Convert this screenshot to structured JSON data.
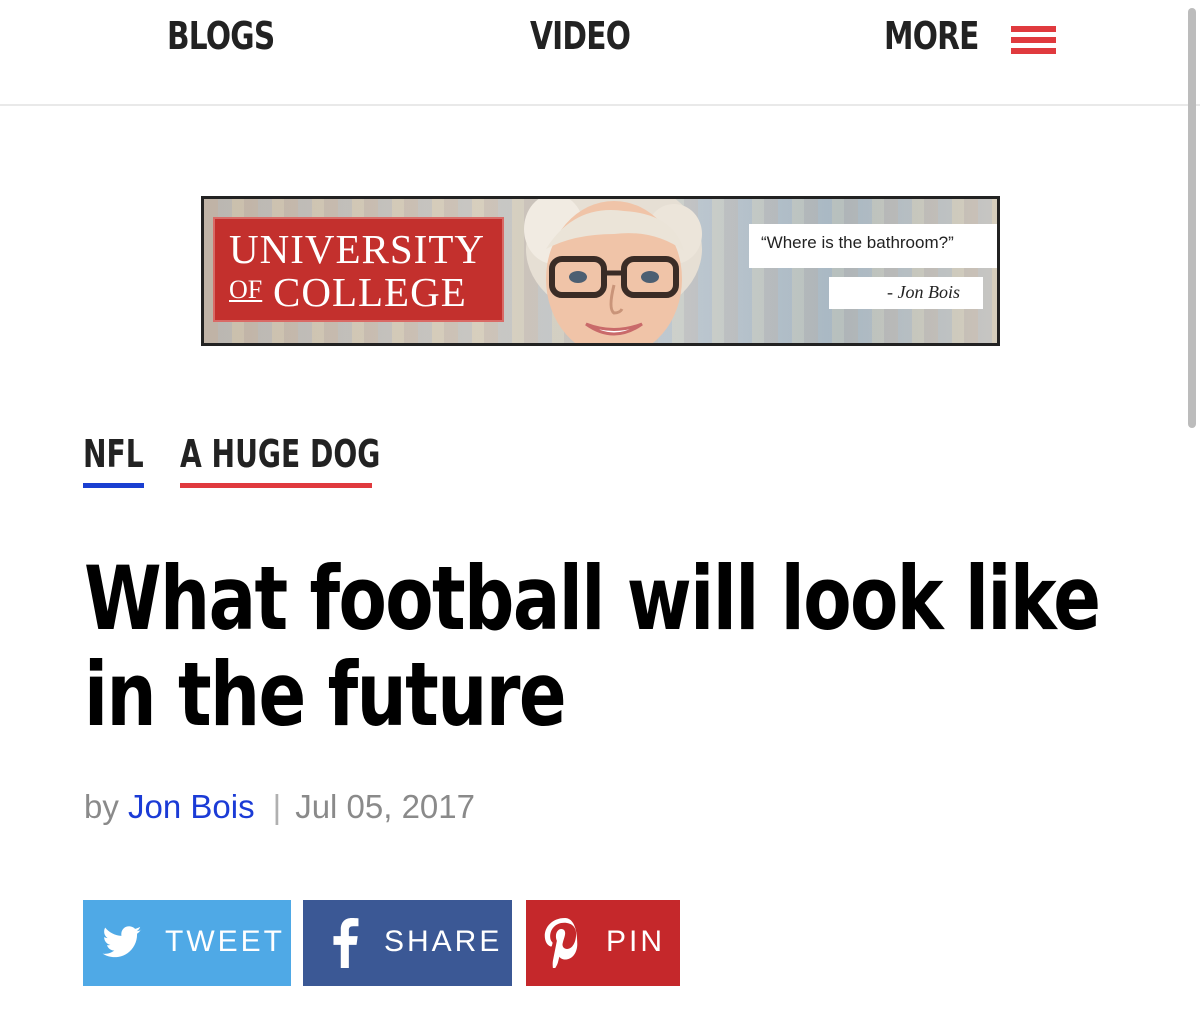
{
  "nav": {
    "blogs": "BLOGS",
    "video": "VIDEO",
    "more": "MORE",
    "menu_icon": "hamburger-menu-icon",
    "menu_color": "#e03a3e"
  },
  "ad": {
    "logo_line1": "UNIVERSITY",
    "logo_of": "OF",
    "logo_line2": "COLLEGE",
    "quote": "“Where is the bathroom?”",
    "attribution": "- Jon Bois",
    "logo_color": "#c3302d"
  },
  "tags": [
    {
      "label": "NFL",
      "underline_color": "#1a3fd1"
    },
    {
      "label": "A HUGE DOG",
      "underline_color": "#e03a3e"
    }
  ],
  "article": {
    "headline_line1": "What football will look like",
    "headline_line2": "in the future",
    "byline_prefix": "by",
    "author": "Jon Bois",
    "separator": "|",
    "date": "Jul 05, 2017"
  },
  "share": {
    "tweet": {
      "label": "TWEET",
      "icon": "twitter-bird-icon",
      "color": "#4fa9e6"
    },
    "share": {
      "label": "SHARE",
      "icon": "facebook-f-icon",
      "color": "#3b5895"
    },
    "pin": {
      "label": "PIN",
      "icon": "pinterest-p-icon",
      "color": "#c5282b"
    }
  }
}
